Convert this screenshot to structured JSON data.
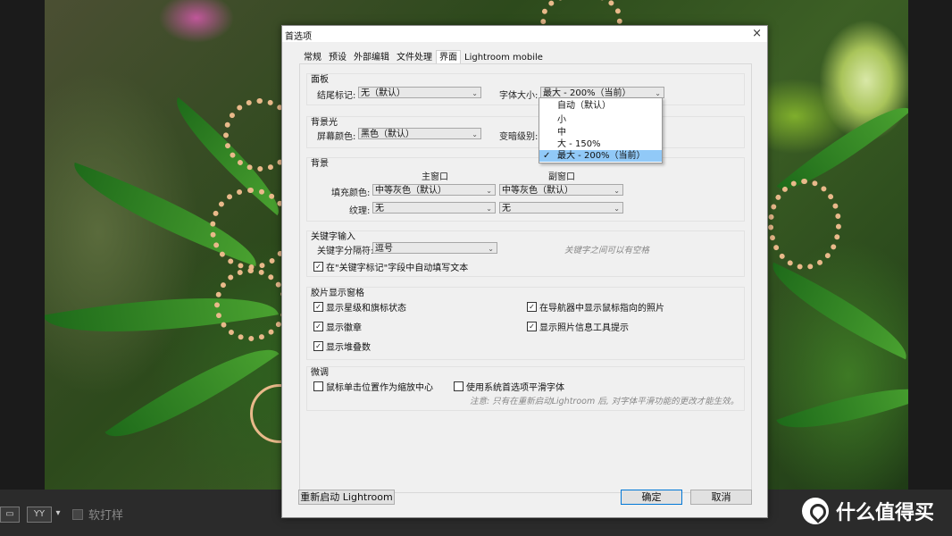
{
  "dialog": {
    "title": "首选项",
    "close": "×",
    "tabs": [
      {
        "label": "常规"
      },
      {
        "label": "预设"
      },
      {
        "label": "外部编辑"
      },
      {
        "label": "文件处理"
      },
      {
        "label": "界面",
        "active": true
      },
      {
        "label": "Lightroom mobile"
      }
    ]
  },
  "panel": {
    "title": "面板",
    "end_marker_label": "结尾标记:",
    "end_marker_value": "无（默认）",
    "font_size_label": "字体大小:",
    "font_size_value": "最大 - 200%（当前）"
  },
  "lights_out": {
    "title": "背景光",
    "screen_color_label": "屏幕颜色:",
    "screen_color_value": "黑色（默认）",
    "dim_level_label": "变暗级别:"
  },
  "background": {
    "title": "背景",
    "main_window": "主窗口",
    "secondary_window": "副窗口",
    "fill_color_label": "填充颜色:",
    "main_fill": "中等灰色（默认）",
    "secondary_fill": "中等灰色（默认）",
    "texture_label": "纹理:",
    "main_texture": "无",
    "secondary_texture": "无"
  },
  "keyword_entry": {
    "title": "关键字输入",
    "separator_label": "关键字分隔符:",
    "separator_value": "逗号",
    "separator_hint": "关键字之间可以有空格",
    "autofill_label": "在\"关键字标记\"字段中自动填写文本",
    "autofill_checked": true
  },
  "filmstrip": {
    "title": "胶片显示窗格",
    "show_ratings": "显示星级和旗标状态",
    "show_badges": "显示徽章",
    "show_stack_counts": "显示堆叠数",
    "show_navigator_photo": "在导航器中显示鼠标指向的照片",
    "show_info_tooltips": "显示照片信息工具提示",
    "checked": true
  },
  "tweaks": {
    "title": "微调",
    "zoom_clicked_point": "鼠标单击位置作为缩放中心",
    "use_system_smoothing": "使用系统首选项平滑字体",
    "note": "注意: 只有在重新启动Lightroom 后, 对字体平滑功能的更改才能生效。"
  },
  "buttons": {
    "restart": "重新启动 Lightroom",
    "ok": "确定",
    "cancel": "取消"
  },
  "font_size_dropdown": {
    "options": [
      {
        "label": "自动（默认）",
        "selected": false
      },
      {
        "label": "小",
        "selected": false
      },
      {
        "label": "中",
        "selected": false
      },
      {
        "label": "大 - 150%",
        "selected": false
      },
      {
        "label": "最大 - 200%（当前）",
        "selected": true
      }
    ],
    "check_mark": "✓"
  },
  "lightroom_toolbar": {
    "view_single": "▭",
    "view_compare": "YY",
    "soft_proofing": "软打样"
  },
  "watermark": {
    "text": "什么值得买"
  }
}
